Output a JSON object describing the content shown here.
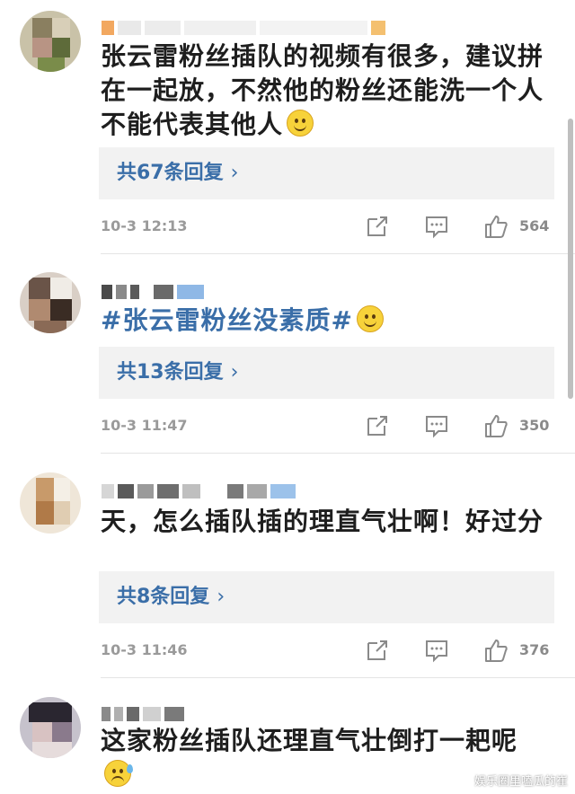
{
  "comments": [
    {
      "text": "张云雷粉丝插队的视频有很多，建议拼在一起放，不然他的粉丝还能洗一个人不能代表其他人",
      "emoji": "smile-emoji",
      "is_hashtag": false,
      "replies": "共67条回复",
      "time": "10-3 12:13",
      "likes": "564"
    },
    {
      "text": "#张云雷粉丝没素质#",
      "emoji": "smile-emoji",
      "is_hashtag": true,
      "replies": "共13条回复",
      "time": "10-3 11:47",
      "likes": "350"
    },
    {
      "text": "天，怎么插队插的理直气壮啊！好过分",
      "emoji": "",
      "is_hashtag": false,
      "replies": "共8条回复",
      "time": "10-3 11:46",
      "likes": "376"
    },
    {
      "text": "这家粉丝插队还理直气壮倒打一耙呢",
      "emoji": "sweat-emoji",
      "is_hashtag": false
    }
  ],
  "reply_chevron": "›",
  "icons": {
    "share": "share-icon",
    "comment": "comment-icon",
    "like": "thumbs-up-icon"
  },
  "colors": {
    "link": "#3a6ea8",
    "reply_bg": "#f2f2f2",
    "meta": "#9a9a9a"
  },
  "watermark": "娱乐圈里嗑瓜的崔"
}
